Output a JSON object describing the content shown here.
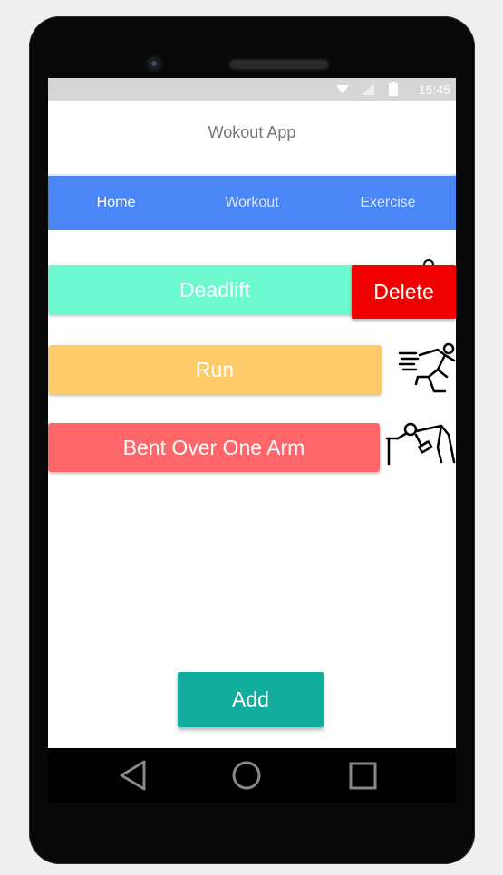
{
  "status_bar": {
    "time": "15:45",
    "icons": [
      "wifi-icon",
      "signal-icon",
      "battery-icon"
    ]
  },
  "app": {
    "title": "Wokout App"
  },
  "tabs": [
    {
      "label": "Home",
      "active": true
    },
    {
      "label": "Workout",
      "active": false
    },
    {
      "label": "Exercise",
      "active": false
    }
  ],
  "exercises": [
    {
      "label": "Deadlift",
      "color": "#6dfad0",
      "icon": "deadlift-icon"
    },
    {
      "label": "Run",
      "color": "#fecb6b",
      "icon": "runner-icon"
    },
    {
      "label": "Bent Over One Arm",
      "color": "#fe666a",
      "icon": "bent-over-row-icon"
    }
  ],
  "actions": {
    "delete_label": "Delete",
    "add_label": "Add"
  },
  "colors": {
    "tab_bar": "#4a86f5",
    "delete": "#f00000",
    "add": "#12ad9c"
  },
  "nav_bar": [
    "back-icon",
    "home-icon",
    "recents-icon"
  ]
}
